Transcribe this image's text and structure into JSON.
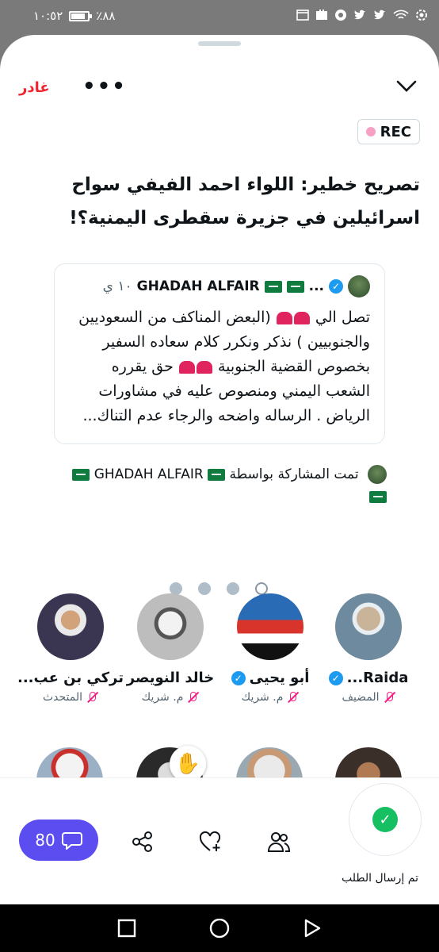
{
  "status_bar": {
    "time": "١٠:٥٢",
    "battery": "٪٨٨"
  },
  "topbar": {
    "leave_label": "غادر",
    "more_label": "•••"
  },
  "rec_label": "REC",
  "space_title": "تصريح خطير: اللواء احمد الفيفي سواح اسرائيلين في جزيرة سقطرى اليمنية؟!",
  "tweet": {
    "author": "GHADAH ALFAIR",
    "ellipsis": "...",
    "time": "١٠ ي",
    "body_1": "تصل الي",
    "body_2": "(البعض المناكف من السعوديين والجنوبيين ) نذكر ونكرر كلام سعاده السفير بخصوص القضية الجنوبية",
    "body_3": "حق يقرره الشعب اليمني ومنصوص عليه في مشاورات الرياض . الرساله واضحه والرجاء عدم التناك..."
  },
  "shared_by": {
    "prefix": "تمت المشاركة بواسطة",
    "name": "GHADAH ALFAIR"
  },
  "pager": {
    "count": 4,
    "active_index": 3
  },
  "speakers": [
    {
      "name": "Raida...",
      "role": "المضيف",
      "verified": true,
      "avatar_color": "#6e8a9e"
    },
    {
      "name": "أبو يحيى",
      "role": "م. شريك",
      "verified": true,
      "avatar_color": "#2a6bb5"
    },
    {
      "name": "خالد النويصر",
      "role": "م. شريك",
      "verified": false,
      "avatar_color": "#8a8a8a"
    },
    {
      "name": "تركي بن عب...",
      "role": "المتحدث",
      "verified": false,
      "avatar_color": "#3a3550"
    }
  ],
  "bottom": {
    "request_label": "تم إرسال الطلب",
    "comment_count": "80"
  },
  "colors": {
    "accent": "#5b4df0",
    "leave": "#f4212e",
    "verified": "#1d9bf0",
    "success": "#17bf63"
  }
}
